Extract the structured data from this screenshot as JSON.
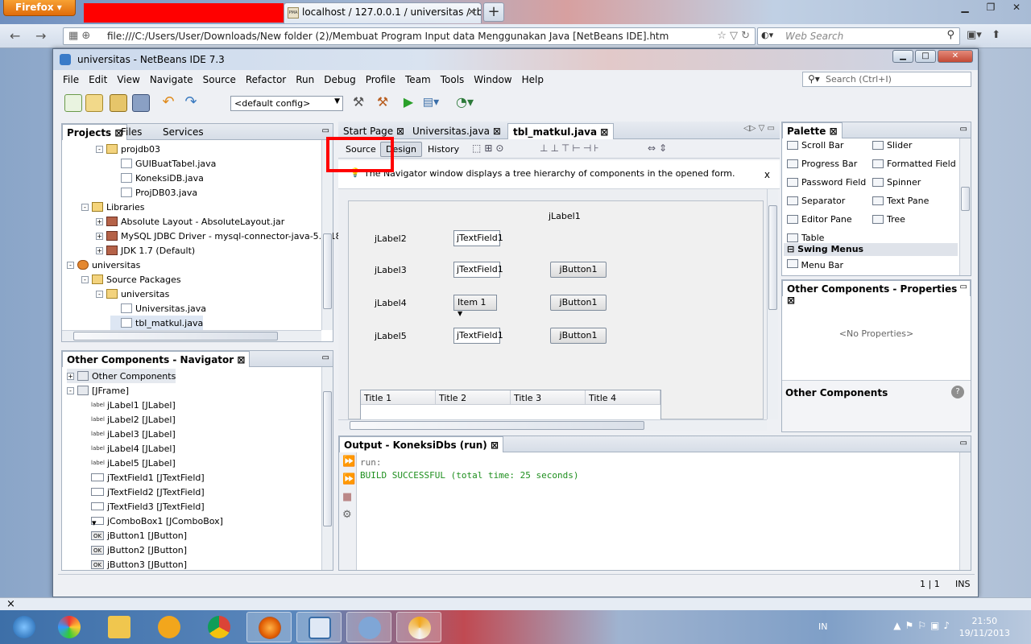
{
  "firefox": {
    "menu_button": "Firefox",
    "active_tab": "localhost / 127.0.0.1 / universitas / tbl...",
    "active_tab_favicon": "PMA",
    "new_tab": "+",
    "url": "file:///C:/Users/User/Downloads/New folder (2)/Membuat Program Input data Menggunakan Java [NetBeans IDE].htm",
    "search_placeholder": "Web Search"
  },
  "netbeans": {
    "title": "universitas - NetBeans IDE 7.3",
    "menus": [
      "File",
      "Edit",
      "View",
      "Navigate",
      "Source",
      "Refactor",
      "Run",
      "Debug",
      "Profile",
      "Team",
      "Tools",
      "Window",
      "Help"
    ],
    "search_placeholder": "Search (Ctrl+I)",
    "config": "<default config>",
    "projects_tabs": [
      "Projects",
      "Files",
      "Services"
    ],
    "project_tree": [
      {
        "label": "projdb03",
        "indent": 2,
        "icon": "pkg",
        "exp": "-"
      },
      {
        "label": "GUIBuatTabel.java",
        "indent": 3,
        "icon": "java",
        "exp": ""
      },
      {
        "label": "KoneksiDB.java",
        "indent": 3,
        "icon": "java",
        "exp": ""
      },
      {
        "label": "ProjDB03.java",
        "indent": 3,
        "icon": "java",
        "exp": ""
      },
      {
        "label": "Libraries",
        "indent": 1,
        "icon": "lib",
        "exp": "-"
      },
      {
        "label": "Absolute Layout - AbsoluteLayout.jar",
        "indent": 2,
        "icon": "jar",
        "exp": "+"
      },
      {
        "label": "MySQL JDBC Driver - mysql-connector-java-5.1.18",
        "indent": 2,
        "icon": "jar",
        "exp": "+"
      },
      {
        "label": "JDK 1.7 (Default)",
        "indent": 2,
        "icon": "jar",
        "exp": "+"
      },
      {
        "label": "universitas",
        "indent": 0,
        "icon": "proj",
        "exp": "-"
      },
      {
        "label": "Source Packages",
        "indent": 1,
        "icon": "pkg",
        "exp": "-"
      },
      {
        "label": "universitas",
        "indent": 2,
        "icon": "pkg",
        "exp": "-"
      },
      {
        "label": "Universitas.java",
        "indent": 3,
        "icon": "java",
        "exp": ""
      },
      {
        "label": "tbl_matkul.java",
        "indent": 3,
        "icon": "java",
        "exp": ""
      }
    ],
    "navigator_title": "Other Components - Navigator",
    "navigator_tree": [
      {
        "label": "Other Components",
        "indent": 0,
        "icon": "gear"
      },
      {
        "label": "[JFrame]",
        "indent": 0,
        "icon": "frame"
      },
      {
        "label": "jLabel1 [JLabel]",
        "indent": 1,
        "icon": "label"
      },
      {
        "label": "jLabel2 [JLabel]",
        "indent": 1,
        "icon": "label"
      },
      {
        "label": "jLabel3 [JLabel]",
        "indent": 1,
        "icon": "label"
      },
      {
        "label": "jLabel4 [JLabel]",
        "indent": 1,
        "icon": "label"
      },
      {
        "label": "jLabel5 [JLabel]",
        "indent": 1,
        "icon": "label"
      },
      {
        "label": "jTextField1 [JTextField]",
        "indent": 1,
        "icon": "tf"
      },
      {
        "label": "jTextField2 [JTextField]",
        "indent": 1,
        "icon": "tf"
      },
      {
        "label": "jTextField3 [JTextField]",
        "indent": 1,
        "icon": "tf"
      },
      {
        "label": "jComboBox1 [JComboBox]",
        "indent": 1,
        "icon": "combo"
      },
      {
        "label": "jButton1 [JButton]",
        "indent": 1,
        "icon": "btn"
      },
      {
        "label": "jButton2 [JButton]",
        "indent": 1,
        "icon": "btn"
      },
      {
        "label": "jButton3 [JButton]",
        "indent": 1,
        "icon": "btn"
      }
    ],
    "editor_tabs": [
      "Start Page",
      "Universitas.java",
      "tbl_matkul.java"
    ],
    "editor_views": [
      "Source",
      "Design",
      "History"
    ],
    "navigator_info": "The Navigator window displays a tree hierarchy of components in the opened form.",
    "close_x": "x",
    "form": {
      "title_label": "jLabel1",
      "labels": [
        "jLabel2",
        "jLabel3",
        "jLabel4",
        "jLabel5"
      ],
      "textfields": [
        "jTextField1",
        "jTextField1",
        "jTextField1"
      ],
      "combo": "Item 1",
      "buttons": [
        "jButton1",
        "jButton1",
        "jButton1"
      ],
      "table_headers": [
        "Title 1",
        "Title 2",
        "Title 3",
        "Title 4"
      ]
    },
    "palette_title": "Palette",
    "palette_items": [
      "Scroll Bar",
      "Slider",
      "Progress Bar",
      "Formatted Field",
      "Password Field",
      "Spinner",
      "Separator",
      "Text Pane",
      "Editor Pane",
      "Tree",
      "Table"
    ],
    "palette_category": "Swing Menus",
    "palette_next": "Menu Bar",
    "props_title": "Other Components - Properties",
    "no_props": "<No Properties>",
    "props_footer": "Other Components",
    "output_title": "Output - KoneksiDbs (run)",
    "output_lines": [
      "run:",
      "BUILD SUCCESSFUL (total time: 25 seconds)"
    ],
    "status_pos": "1 | 1",
    "status_mode": "INS"
  },
  "bottom_close": "×",
  "taskbar": {
    "lang": "IN",
    "time": "21:50",
    "date": "19/11/2013"
  }
}
